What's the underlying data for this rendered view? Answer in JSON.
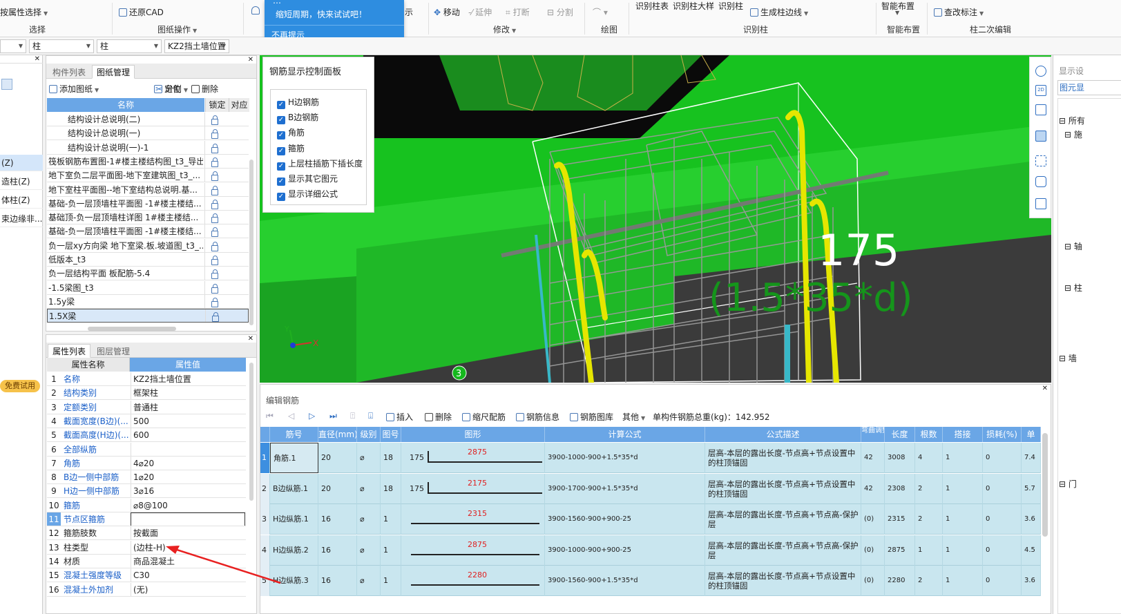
{
  "ribbon": {
    "select_btn": "按属性选择",
    "select_group": "选择",
    "restore_cad": "还原CAD",
    "drawing_ops": "图纸操作",
    "move": "移动",
    "extend": "延伸",
    "break": "打断",
    "split": "分割",
    "modify_group": "修改",
    "draw_group": "绘图",
    "id_col_table": "识别柱表",
    "id_col_detail": "识别柱大样",
    "id_col": "识别柱",
    "gen_col_edge": "生成柱边线",
    "id_group": "识别柱",
    "smart_layout": "智能布置",
    "smart_group": "智能布置",
    "check_mark": "查改标注",
    "col2_group": "柱二次编辑"
  },
  "tooltip": {
    "line1": "…",
    "line2": "缩短周期，快来试试吧！",
    "dismiss": "不再提示"
  },
  "combos": {
    "c1": "",
    "c2": "柱",
    "c3": "柱",
    "c4": "KZ2挡土墙位置"
  },
  "left_edge": {
    "items": [
      "(Z)",
      "造柱(Z)",
      "体柱(Z)",
      "束边缘非..."
    ],
    "trial": "免费试用"
  },
  "drawing_panel": {
    "tab_components": "构件列表",
    "tab_drawings": "图纸管理",
    "add_drawing": "添加图纸",
    "split": "分割",
    "locate": "定位",
    "delete": "删除",
    "col_name": "名称",
    "col_lock": "锁定",
    "col_match": "对应",
    "rows": [
      "结构设计总说明(二)",
      "结构设计总说明(一)",
      "结构设计总说明(一)-1",
      "筏板钢筋布置图-1#楼主楼结构图_t3_导出",
      "地下室负二层平面图-地下室建筑图_t3_...",
      "地下室柱平面图--地下室结构总说明.基...",
      "基础-负一层顶墙柱平面图 -1#楼主楼结...",
      "基础顶-负一层顶墙柱详图 1#楼主楼结...",
      "基础-负一层顶墙柱平面图 -1#楼主楼结...",
      "负一层xy方向梁 地下室梁.板.坡道图_t3_...",
      "低版本_t3",
      "负一层结构平面 板配筋-5.4",
      "-1.5梁图_t3",
      "1.5y梁",
      "1.5X梁"
    ]
  },
  "prop_panel": {
    "tab_props": "属性列表",
    "tab_layers": "图层管理",
    "col_name": "属性名称",
    "col_value": "属性值",
    "rows": [
      {
        "n": "1",
        "name": "名称",
        "value": "KZ2挡土墙位置"
      },
      {
        "n": "2",
        "name": "结构类别",
        "value": "框架柱"
      },
      {
        "n": "3",
        "name": "定额类别",
        "value": "普通柱"
      },
      {
        "n": "4",
        "name": "截面宽度(B边)(...",
        "value": "500"
      },
      {
        "n": "5",
        "name": "截面高度(H边)(...",
        "value": "600"
      },
      {
        "n": "6",
        "name": "全部纵筋",
        "value": ""
      },
      {
        "n": "7",
        "name": "角筋",
        "value": "4⌀20"
      },
      {
        "n": "8",
        "name": "B边一侧中部筋",
        "value": "1⌀20"
      },
      {
        "n": "9",
        "name": "H边一侧中部筋",
        "value": "3⌀16"
      },
      {
        "n": "10",
        "name": "箍筋",
        "value": "⌀8@100"
      },
      {
        "n": "11",
        "name": "节点区箍筋",
        "value": ""
      },
      {
        "n": "12",
        "name": "箍筋肢数",
        "value": "按截面"
      },
      {
        "n": "13",
        "name": "柱类型",
        "value": "(边柱-H)"
      },
      {
        "n": "14",
        "name": "材质",
        "value": "商品混凝土"
      },
      {
        "n": "15",
        "name": "混凝土强度等级",
        "value": "C30"
      },
      {
        "n": "16",
        "name": "混凝土外加剂",
        "value": "(无)"
      }
    ]
  },
  "viewport": {
    "panel_title": "钢筋显示控制面板",
    "checks": [
      "H边钢筋",
      "B边钢筋",
      "角筋",
      "箍筋",
      "上层柱插筋下插长度",
      "显示其它图元",
      "显示详细公式"
    ],
    "label_value": "175",
    "label_formula": "(1.5*35*d)",
    "marker": "3",
    "axis_x": "X",
    "axis_y": "Y"
  },
  "right_panel": {
    "title": "显示设",
    "sub": "图元显",
    "items": [
      "所有",
      "施",
      "轴",
      "柱",
      "墙",
      "门"
    ]
  },
  "edit_panel": {
    "title": "编辑钢筋",
    "insert": "插入",
    "delete": "删除",
    "scale": "缩尺配筋",
    "info": "钢筋信息",
    "lib": "钢筋图库",
    "other": "其他",
    "total": "单构件钢筋总重(kg)：142.952",
    "headers": [
      "筋号",
      "直径(mm)",
      "级别",
      "图号",
      "图形",
      "计算公式",
      "公式描述",
      "弯曲调整",
      "长度",
      "根数",
      "搭接",
      "损耗(%)",
      "单"
    ],
    "rows": [
      {
        "n": "1",
        "name": "角筋.1",
        "dia": "20",
        "grade": "⌀",
        "fig": "18",
        "left": "175",
        "mid": "2875",
        "formula": "3900-1000-900+1.5*35*d",
        "desc": "层高-本层的露出长度-节点高+节点设置中的柱顶锚固",
        "bend": "42",
        "len": "3008",
        "count": "4",
        "lap": "1",
        "loss": "0",
        "unit": "7.4"
      },
      {
        "n": "2",
        "name": "B边纵筋.1",
        "dia": "20",
        "grade": "⌀",
        "fig": "18",
        "left": "175",
        "mid": "2175",
        "formula": "3900-1700-900+1.5*35*d",
        "desc": "层高-本层的露出长度-节点高+节点设置中的柱顶锚固",
        "bend": "42",
        "len": "2308",
        "count": "2",
        "lap": "1",
        "loss": "0",
        "unit": "5.7"
      },
      {
        "n": "3",
        "name": "H边纵筋.1",
        "dia": "16",
        "grade": "⌀",
        "fig": "1",
        "left": "",
        "mid": "2315",
        "formula": "3900-1560-900+900-25",
        "desc": "层高-本层的露出长度-节点高+节点高-保护层",
        "bend": "(0)",
        "len": "2315",
        "count": "2",
        "lap": "1",
        "loss": "0",
        "unit": "3.6"
      },
      {
        "n": "4",
        "name": "H边纵筋.2",
        "dia": "16",
        "grade": "⌀",
        "fig": "1",
        "left": "",
        "mid": "2875",
        "formula": "3900-1000-900+900-25",
        "desc": "层高-本层的露出长度-节点高+节点高-保护层",
        "bend": "(0)",
        "len": "2875",
        "count": "1",
        "lap": "1",
        "loss": "0",
        "unit": "4.5"
      },
      {
        "n": "5",
        "name": "H边纵筋.3",
        "dia": "16",
        "grade": "⌀",
        "fig": "1",
        "left": "",
        "mid": "2280",
        "formula": "3900-1560-900+1.5*35*d",
        "desc": "层高-本层的露出长度-节点高+节点设置中的柱顶锚固",
        "bend": "(0)",
        "len": "2280",
        "count": "2",
        "lap": "1",
        "loss": "0",
        "unit": "3.6"
      }
    ]
  },
  "colors": {
    "accent": "#2e8de0",
    "header_blue": "#6aa6e6",
    "grid_row": "#c9e6ef",
    "viewport_green": "#22c22a",
    "rebar_yellow": "#e6e600",
    "link_blue": "#1a5fc8"
  }
}
